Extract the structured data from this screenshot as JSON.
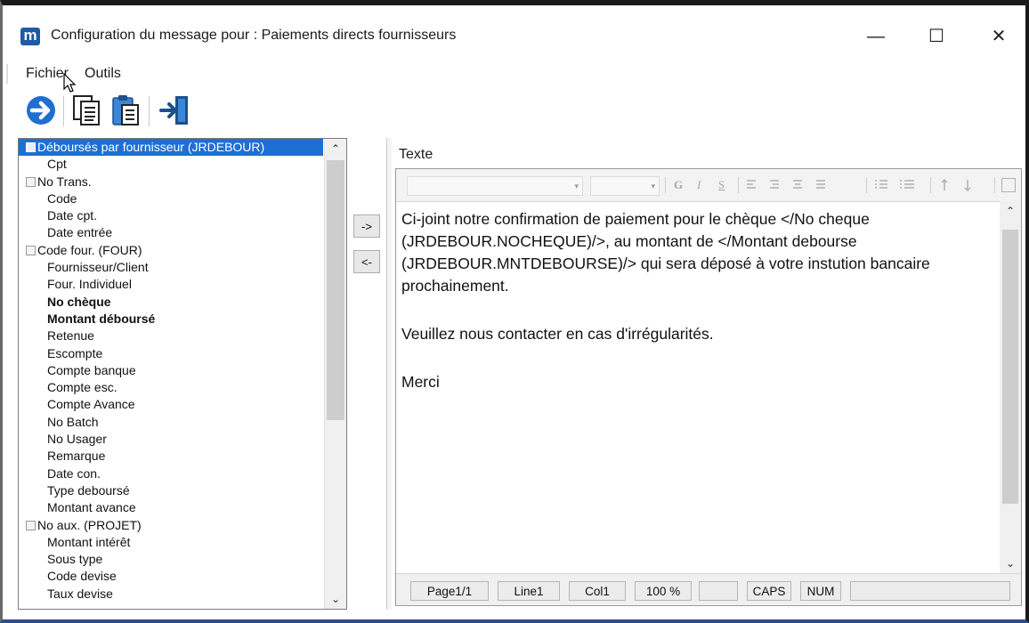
{
  "window": {
    "title": "Configuration du message pour : Paiements directs fournisseurs",
    "app_icon": "m",
    "minimize": "—",
    "maximize": "☐",
    "close": "✕"
  },
  "menu": {
    "file": "Fichier",
    "tools": "Outils"
  },
  "toolbar": {
    "icons": [
      "arrow-right-circle-icon",
      "copy-icon",
      "paste-icon",
      "exit-icon"
    ]
  },
  "tree": {
    "items": [
      {
        "label": "Déboursés par fournisseur (JRDEBOUR)",
        "level": 0,
        "expandable": true,
        "selected": true
      },
      {
        "label": "Cpt",
        "level": 1
      },
      {
        "label": "No Trans.",
        "level": 0,
        "expandable": true
      },
      {
        "label": "Code",
        "level": 1
      },
      {
        "label": "Date cpt.",
        "level": 1
      },
      {
        "label": "Date entrée",
        "level": 1
      },
      {
        "label": "Code four. (FOUR)",
        "level": 0,
        "expandable": true
      },
      {
        "label": "Fournisseur/Client",
        "level": 1
      },
      {
        "label": "Four. Individuel",
        "level": 1
      },
      {
        "label": "No chèque",
        "level": 1,
        "bold": true
      },
      {
        "label": "Montant déboursé",
        "level": 1,
        "bold": true
      },
      {
        "label": "Retenue",
        "level": 1
      },
      {
        "label": "Escompte",
        "level": 1
      },
      {
        "label": "Compte banque",
        "level": 1
      },
      {
        "label": "Compte esc.",
        "level": 1
      },
      {
        "label": "Compte Avance",
        "level": 1
      },
      {
        "label": "No Batch",
        "level": 1
      },
      {
        "label": "No Usager",
        "level": 1
      },
      {
        "label": "Remarque",
        "level": 1
      },
      {
        "label": "Date con.",
        "level": 1
      },
      {
        "label": "Type deboursé",
        "level": 1
      },
      {
        "label": "Montant avance",
        "level": 1
      },
      {
        "label": "No aux. (PROJET)",
        "level": 0,
        "expandable": true
      },
      {
        "label": "Montant intérêt",
        "level": 1
      },
      {
        "label": "Sous type",
        "level": 1
      },
      {
        "label": "Code devise",
        "level": 1
      },
      {
        "label": "Taux devise",
        "level": 1
      }
    ],
    "scroll_up": "⌃",
    "scroll_down": "⌄"
  },
  "transfer": {
    "add": "->",
    "remove": "<-"
  },
  "editor": {
    "label": "Texte",
    "format_buttons": [
      "G",
      "I",
      "S"
    ],
    "paragraphs": [
      "Ci-joint notre confirmation de paiement pour le chèque </No cheque (JRDEBOUR.NOCHEQUE)/>, au montant de </Montant debourse (JRDEBOUR.MNTDEBOURSE)/> qui sera déposé à votre instution bancaire prochainement.",
      "Veuillez nous contacter en cas d'irrégularités.",
      "Merci"
    ]
  },
  "status": {
    "page": "Page1/1",
    "line": "Line1",
    "col": "Col1",
    "zoom": "100 %",
    "blank": "",
    "caps": "CAPS",
    "num": "NUM"
  }
}
